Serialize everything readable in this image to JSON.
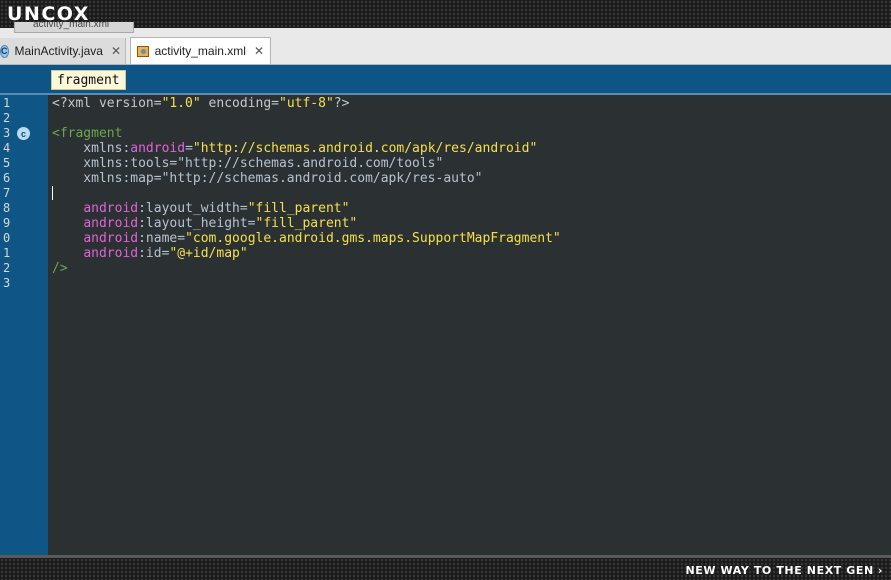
{
  "branding": {
    "logo": "UNCOX",
    "tagline": "NEW WAY TO THE NEXT GEN",
    "tagline_chevron": "›"
  },
  "tabs": {
    "ghost_label": "activity_main.xml",
    "items": [
      {
        "label": "MainActivity.java",
        "icon": "java-class-icon",
        "icon_glyph": "C",
        "active": false
      },
      {
        "label": "activity_main.xml",
        "icon": "xml-layout-icon",
        "active": true
      }
    ],
    "close_glyph": "✕"
  },
  "breadcrumb": {
    "label": "fragment"
  },
  "editor": {
    "line_numbers": [
      "1",
      "2",
      "3",
      "4",
      "5",
      "6",
      "7",
      "8",
      "9",
      "0",
      "1",
      "2",
      "3"
    ],
    "gutter_marker": {
      "line": 3,
      "glyph": "c"
    },
    "lines": [
      [
        {
          "t": "<?xml version=",
          "c": "prolog"
        },
        {
          "t": "\"1.0\"",
          "c": "str"
        },
        {
          "t": " encoding=",
          "c": "prolog"
        },
        {
          "t": "\"utf-8\"",
          "c": "str"
        },
        {
          "t": "?>",
          "c": "prolog"
        }
      ],
      [],
      [
        {
          "t": "<fragment",
          "c": "tag"
        }
      ],
      [
        {
          "t": "    xmlns:",
          "c": "attr"
        },
        {
          "t": "android",
          "c": "ns"
        },
        {
          "t": "=",
          "c": "attr"
        },
        {
          "t": "\"http://schemas.android.com/apk/res/android\"",
          "c": "str"
        }
      ],
      [
        {
          "t": "    xmlns:tools=\"http://schemas.android.com/tools\"",
          "c": "attr"
        }
      ],
      [
        {
          "t": "    xmlns:map=\"http://schemas.android.com/apk/res-auto\"",
          "c": "attr"
        }
      ],
      [],
      [
        {
          "t": "    ",
          "c": "attr"
        },
        {
          "t": "android",
          "c": "ns"
        },
        {
          "t": ":layout_width=",
          "c": "attr"
        },
        {
          "t": "\"fill_parent\"",
          "c": "str"
        }
      ],
      [
        {
          "t": "    ",
          "c": "attr"
        },
        {
          "t": "android",
          "c": "ns"
        },
        {
          "t": ":layout_height=",
          "c": "attr"
        },
        {
          "t": "\"fill_parent\"",
          "c": "str"
        }
      ],
      [
        {
          "t": "    ",
          "c": "attr"
        },
        {
          "t": "android",
          "c": "ns"
        },
        {
          "t": ":name=",
          "c": "attr"
        },
        {
          "t": "\"com.google.android.gms.maps.SupportMapFragment\"",
          "c": "str"
        }
      ],
      [
        {
          "t": "    ",
          "c": "attr"
        },
        {
          "t": "android",
          "c": "ns"
        },
        {
          "t": ":id=",
          "c": "attr"
        },
        {
          "t": "\"@+id/map\"",
          "c": "str"
        }
      ],
      [
        {
          "t": "/>",
          "c": "tag"
        }
      ],
      []
    ]
  },
  "colors": {
    "gutter": "#0f5585",
    "editor_bg": "#2b3033",
    "string": "#f4e04d",
    "namespace": "#e064d6",
    "tag": "#6aa84f"
  }
}
